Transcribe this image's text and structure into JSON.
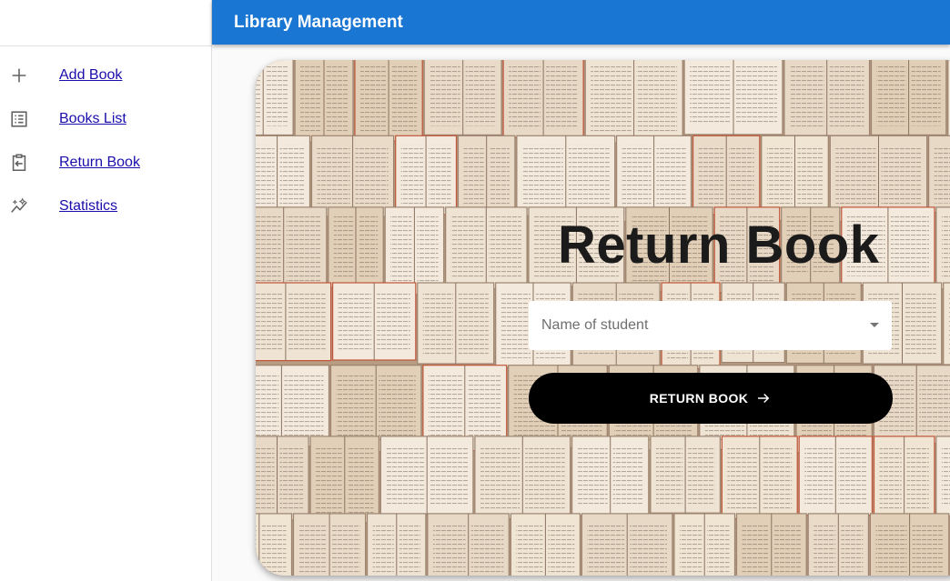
{
  "header": {
    "title": "Library Management",
    "color": "#1976d2"
  },
  "sidebar": {
    "items": [
      {
        "label": "Add Book",
        "icon": "plus-icon"
      },
      {
        "label": "Books List",
        "icon": "list-icon"
      },
      {
        "label": "Return Book",
        "icon": "return-icon"
      },
      {
        "label": "Statistics",
        "icon": "insights-icon"
      }
    ]
  },
  "main": {
    "title": "Return Book",
    "student_select": {
      "placeholder": "Name of student",
      "icon": "dropdown-arrow-icon"
    },
    "return_button": {
      "label": "RETURN BOOK",
      "icon": "arrow-right-icon"
    },
    "background": "open-books-wall"
  }
}
